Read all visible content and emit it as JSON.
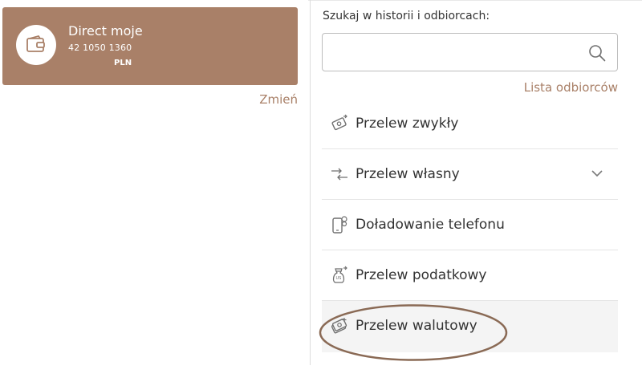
{
  "account": {
    "name": "Direct moje",
    "number": "42 1050 1360",
    "currency": "PLN",
    "change_label": "Zmień",
    "icon": "wallet-icon"
  },
  "search": {
    "label": "Szukaj w historii i odbiorcach:",
    "value": "",
    "placeholder": "",
    "icon": "search-icon"
  },
  "recipients_link": "Lista odbiorców",
  "menu": {
    "items": [
      {
        "label": "Przelew zwykły",
        "icon": "transfer-note-icon"
      },
      {
        "label": "Przelew własny",
        "icon": "own-transfer-arrows-icon",
        "expandable": true
      },
      {
        "label": "Doładowanie telefonu",
        "icon": "phone-topup-icon"
      },
      {
        "label": "Przelew podatkowy",
        "icon": "tax-bag-icon"
      },
      {
        "label": "Przelew walutowy",
        "icon": "currency-transfer-icon",
        "highlighted": true
      }
    ]
  },
  "colors": {
    "accent": "#a98068",
    "highlight_ring": "#8a6a55",
    "icon_stroke": "#6f6f6f"
  }
}
